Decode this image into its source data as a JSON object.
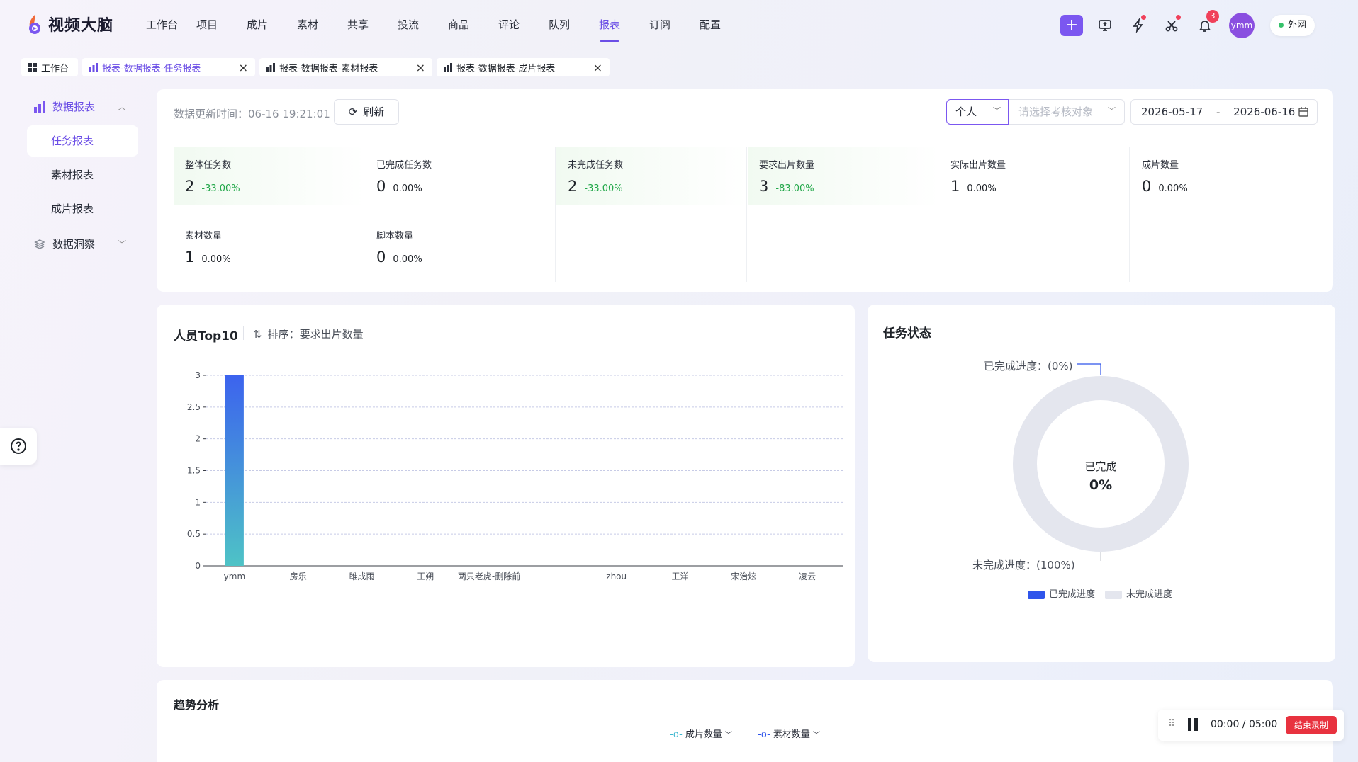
{
  "app": {
    "name": "视频大脑"
  },
  "nav": [
    "工作台",
    "项目",
    "成片",
    "素材",
    "共享",
    "投流",
    "商品",
    "评论",
    "队列",
    "报表",
    "订阅",
    "配置"
  ],
  "nav_active": "报表",
  "topbar": {
    "notification_count": "3",
    "avatar_text": "ymm",
    "network_label": "外网"
  },
  "tabs": [
    {
      "label": "工作台",
      "closable": false
    },
    {
      "label": "报表-数据报表-任务报表",
      "closable": true,
      "active": true
    },
    {
      "label": "报表-数据报表-素材报表",
      "closable": true
    },
    {
      "label": "报表-数据报表-成片报表",
      "closable": true
    }
  ],
  "sidebar": {
    "group1": "数据报表",
    "items": [
      "任务报表",
      "素材报表",
      "成片报表"
    ],
    "group2": "数据洞察"
  },
  "toolbar": {
    "update_label": "数据更新时间：",
    "update_time": "06-16 19:21:01",
    "refresh": "刷新",
    "scope": "个人",
    "target_placeholder": "请选择考核对象",
    "date_start": "2026-05-17",
    "date_sep": "-",
    "date_end": "2026-06-16"
  },
  "stats": [
    {
      "label": "整体任务数",
      "value": "2",
      "pct": "-33.00%",
      "highlight": true
    },
    {
      "label": "已完成任务数",
      "value": "0",
      "pct": "0.00%",
      "highlight": false
    },
    {
      "label": "未完成任务数",
      "value": "2",
      "pct": "-33.00%",
      "highlight": true
    },
    {
      "label": "要求出片数量",
      "value": "3",
      "pct": "-83.00%",
      "highlight": true
    },
    {
      "label": "实际出片数量",
      "value": "1",
      "pct": "0.00%",
      "highlight": false
    },
    {
      "label": "成片数量",
      "value": "0",
      "pct": "0.00%",
      "highlight": false
    },
    {
      "label": "素材数量",
      "value": "1",
      "pct": "0.00%",
      "highlight": false
    },
    {
      "label": "脚本数量",
      "value": "0",
      "pct": "0.00%",
      "highlight": false
    }
  ],
  "top10": {
    "title": "人员Top10",
    "sort_label": "排序：",
    "sort_value": "要求出片数量"
  },
  "chart_data": [
    {
      "type": "bar",
      "title": "人员Top10",
      "categories": [
        "ymm",
        "房乐",
        "雎成雨",
        "王朔",
        "两只老虎-删除前",
        "",
        "zhou",
        "王洋",
        "宋治炫",
        "凌云"
      ],
      "values": [
        3,
        0,
        0,
        0,
        0,
        0,
        0,
        0,
        0,
        0
      ],
      "ylim": [
        0,
        3
      ],
      "yticks": [
        "0",
        "0.5",
        "1",
        "1.5",
        "2",
        "2.5",
        "3"
      ],
      "grid": true
    },
    {
      "type": "pie",
      "title": "任务状态",
      "labels": [
        "已完成进度",
        "未完成进度"
      ],
      "values": [
        0,
        100
      ],
      "colors": [
        "#2f55eb",
        "#e4e6ee"
      ]
    }
  ],
  "status": {
    "title": "任务状态",
    "done_callout": "已完成进度：(0%)",
    "todo_callout": "未完成进度：(100%)",
    "center_label": "已完成",
    "center_value": "0%",
    "legend_done": "已完成进度",
    "legend_todo": "未完成进度"
  },
  "trend": {
    "title": "趋势分析",
    "metric1": "成片数量",
    "metric2": "素材数量"
  },
  "recording": {
    "time": "00:00 / 05:00",
    "stop": "结束录制"
  }
}
